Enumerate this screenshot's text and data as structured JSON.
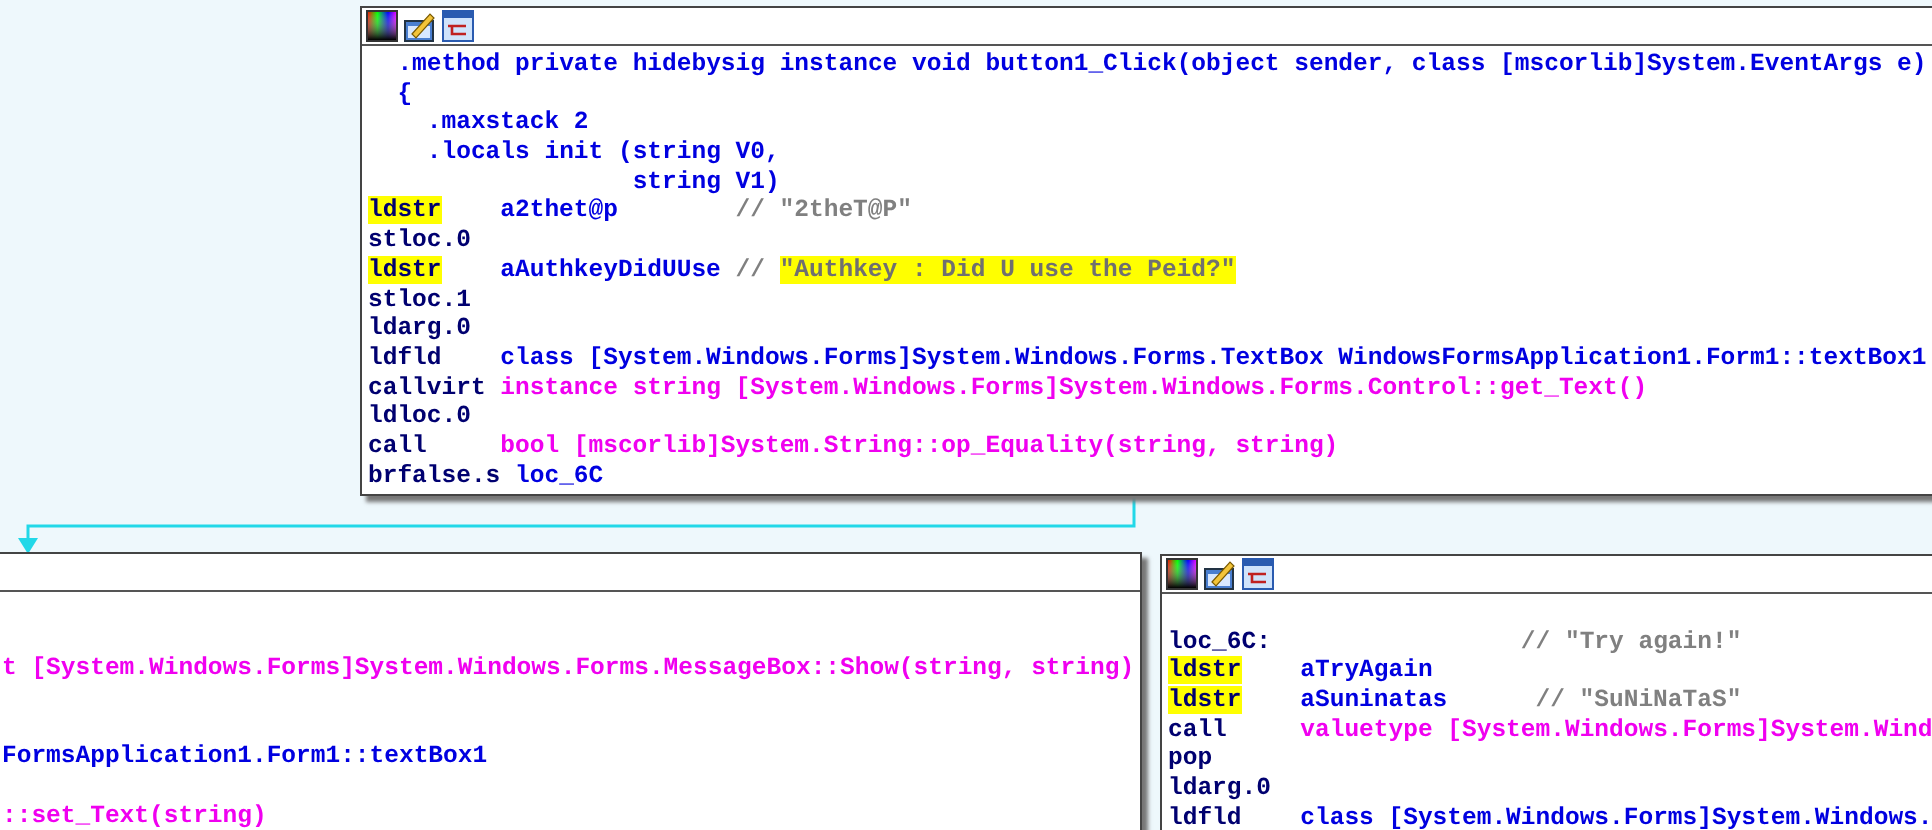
{
  "nodes": [
    {
      "kind": "full",
      "lines": [
        {
          "kind": "code",
          "segments": [
            {
              "kind": "directive",
              "text": "  .method private hidebysig instance void button1_Click(object sender, class [mscorlib]System.EventArgs e)"
            }
          ]
        },
        {
          "kind": "code",
          "segments": [
            {
              "kind": "directive",
              "text": "  {"
            }
          ]
        },
        {
          "kind": "code",
          "segments": [
            {
              "kind": "directive",
              "text": "    .maxstack 2"
            }
          ]
        },
        {
          "kind": "code",
          "segments": [
            {
              "kind": "directive",
              "text": "    .locals init (string V0,"
            }
          ]
        },
        {
          "kind": "code",
          "segments": [
            {
              "kind": "directive",
              "text": "                  string V1)"
            }
          ]
        },
        {
          "kind": "code",
          "segments": [
            {
              "kind": "mnemonic_marked",
              "text": "ldstr"
            },
            {
              "kind": "operand",
              "text": "a2thet@p"
            },
            {
              "kind": "comment",
              "text": "// \"2theT@P\""
            }
          ]
        },
        {
          "kind": "code",
          "segments": [
            {
              "kind": "mnemonic",
              "text": "stloc.0"
            }
          ]
        },
        {
          "kind": "code",
          "segments": [
            {
              "kind": "mnemonic_marked",
              "text": "ldstr"
            },
            {
              "kind": "operand",
              "text": "aAuthkeyDidUUse"
            },
            {
              "kind": "comment",
              "text": "//"
            },
            {
              "kind": "string_marked",
              "text": "\"Authkey : Did U use the Peid?\""
            }
          ]
        },
        {
          "kind": "code",
          "segments": [
            {
              "kind": "mnemonic",
              "text": "stloc.1"
            }
          ]
        },
        {
          "kind": "code",
          "segments": [
            {
              "kind": "mnemonic",
              "text": "ldarg.0"
            }
          ]
        },
        {
          "kind": "code",
          "segments": [
            {
              "kind": "mnemonic",
              "text": "ldfld"
            },
            {
              "kind": "operand",
              "text": "class [System.Windows.Forms]System.Windows.Forms.TextBox WindowsFormsApplication1.Form1::textBox1"
            }
          ]
        },
        {
          "kind": "code",
          "segments": [
            {
              "kind": "mnemonic",
              "text": "callvirt"
            },
            {
              "kind": "call",
              "text": "instance string [System.Windows.Forms]System.Windows.Forms.Control::get_Text()"
            }
          ]
        },
        {
          "kind": "code",
          "segments": [
            {
              "kind": "mnemonic",
              "text": "ldloc.0"
            }
          ]
        },
        {
          "kind": "code",
          "segments": [
            {
              "kind": "mnemonic",
              "text": "call"
            },
            {
              "kind": "call",
              "text": "bool [mscorlib]System.String::op_Equality(string, string)"
            }
          ]
        },
        {
          "kind": "code",
          "segments": [
            {
              "kind": "mnemonic",
              "text": "brfalse.s"
            },
            {
              "kind": "operand_plain",
              "text": "loc_6C"
            }
          ]
        }
      ]
    },
    {
      "kind": "clipped",
      "lines": [
        {
          "kind": "blank"
        },
        {
          "kind": "blank"
        },
        {
          "kind": "code",
          "segments": [
            {
              "kind": "call",
              "text": "t [System.Windows.Forms]System.Windows.Forms.MessageBox::Show(string, string)"
            }
          ]
        },
        {
          "kind": "blank"
        },
        {
          "kind": "blank"
        },
        {
          "kind": "code",
          "segments": [
            {
              "kind": "operand_plain",
              "text": "FormsApplication1.Form1::textBox1"
            }
          ]
        },
        {
          "kind": "blank"
        },
        {
          "kind": "code",
          "segments": [
            {
              "kind": "call",
              "text": "::set_Text(string)"
            }
          ]
        }
      ]
    },
    {
      "kind": "full",
      "lines": [
        {
          "kind": "blank"
        },
        {
          "kind": "code",
          "segments": [
            {
              "kind": "label",
              "text": "loc_6C:"
            },
            {
              "kind": "comment",
              "text": "// \"Try again!\""
            }
          ]
        },
        {
          "kind": "code",
          "segments": [
            {
              "kind": "mnemonic_marked",
              "text": "ldstr"
            },
            {
              "kind": "operand_plain",
              "text": "aTryAgain"
            }
          ]
        },
        {
          "kind": "code",
          "segments": [
            {
              "kind": "mnemonic_marked",
              "text": "ldstr"
            },
            {
              "kind": "operand",
              "text": "aSuninatas"
            },
            {
              "kind": "comment",
              "text": "// \"SuNiNaTaS\""
            }
          ]
        },
        {
          "kind": "code",
          "segments": [
            {
              "kind": "mnemonic",
              "text": "call"
            },
            {
              "kind": "call",
              "text": "valuetype [System.Windows.Forms]System.Wind"
            }
          ]
        },
        {
          "kind": "code",
          "segments": [
            {
              "kind": "mnemonic",
              "text": "pop"
            }
          ]
        },
        {
          "kind": "code",
          "segments": [
            {
              "kind": "mnemonic",
              "text": "ldarg.0"
            }
          ]
        },
        {
          "kind": "code",
          "segments": [
            {
              "kind": "mnemonic",
              "text": "ldfld"
            },
            {
              "kind": "operand_plain",
              "text": "class [System.Windows.Forms]System.Windows."
            }
          ]
        }
      ]
    }
  ]
}
